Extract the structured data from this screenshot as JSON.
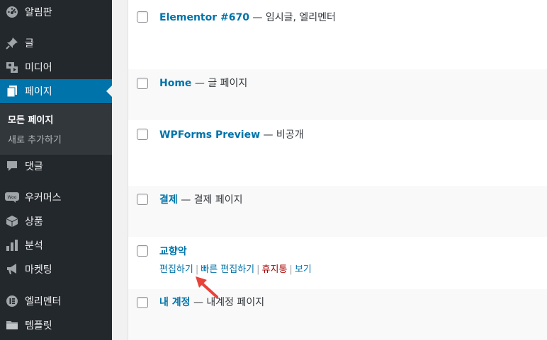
{
  "sidebar": {
    "items": [
      {
        "label": "알림판",
        "icon": "dashboard-icon"
      },
      {
        "label": "글",
        "icon": "pin-icon"
      },
      {
        "label": "미디어",
        "icon": "media-icon"
      },
      {
        "label": "페이지",
        "icon": "pages-icon",
        "active": true
      },
      {
        "label": "댓글",
        "icon": "comment-icon"
      },
      {
        "label": "우커머스",
        "icon": "woo-icon"
      },
      {
        "label": "상품",
        "icon": "box-icon"
      },
      {
        "label": "분석",
        "icon": "bar-chart-icon"
      },
      {
        "label": "마켓팅",
        "icon": "megaphone-icon"
      },
      {
        "label": "엘리멘터",
        "icon": "elementor-icon"
      },
      {
        "label": "템플릿",
        "icon": "folder-icon"
      }
    ],
    "submenu": [
      {
        "label": "모든 페이지",
        "current": true
      },
      {
        "label": "새로 추가하기"
      }
    ]
  },
  "pages": [
    {
      "title": "Elementor #670",
      "state": " — 임시글, 엘리멘터"
    },
    {
      "title": "Home",
      "state": " — 글 페이지"
    },
    {
      "title": "WPForms Preview",
      "state": " — 비공개"
    },
    {
      "title": "결제",
      "state": " — 결제 페이지"
    },
    {
      "title": "교향악",
      "state": ""
    },
    {
      "title": "내 계정",
      "state": " — 내계정 페이지"
    }
  ],
  "row_actions": {
    "edit": "편집하기",
    "quick_edit": "빠른 편집하기",
    "trash": "휴지통",
    "view": "보기",
    "separator": "|"
  },
  "colors": {
    "sidebar_bg": "#23282d",
    "submenu_bg": "#32373c",
    "active_bg": "#0073aa",
    "link": "#0073aa",
    "trash": "#aa0000",
    "annotation_arrow": "#e8423a"
  }
}
